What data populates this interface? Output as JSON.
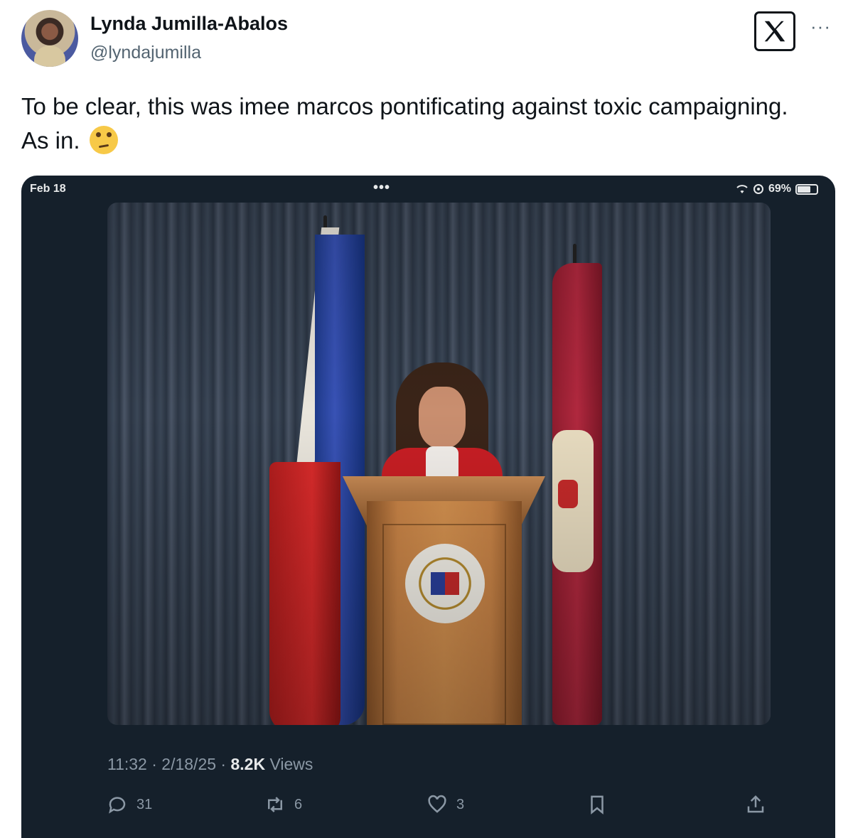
{
  "author": {
    "name": "Lynda Jumilla-Abalos",
    "handle": "@lyndajumilla"
  },
  "header": {
    "logo_text": "X",
    "more_label": "···"
  },
  "tweet": {
    "text": "To be clear, this was imee marcos pontificating against toxic campaigning. As in.",
    "emoji": "face-with-rolling-eyes"
  },
  "embedded_screenshot": {
    "status_date": "Feb 18",
    "status_dots": "•••",
    "battery_percent": "69%",
    "timestamp": "11:32 · 2/18/25 · ",
    "views_count": "8.2K",
    "views_label": " Views",
    "actions": {
      "replies": "31",
      "reposts": "6",
      "likes": "3"
    }
  },
  "colors": {
    "embed_background": "#15202b",
    "muted_text": "#8b98a5"
  }
}
